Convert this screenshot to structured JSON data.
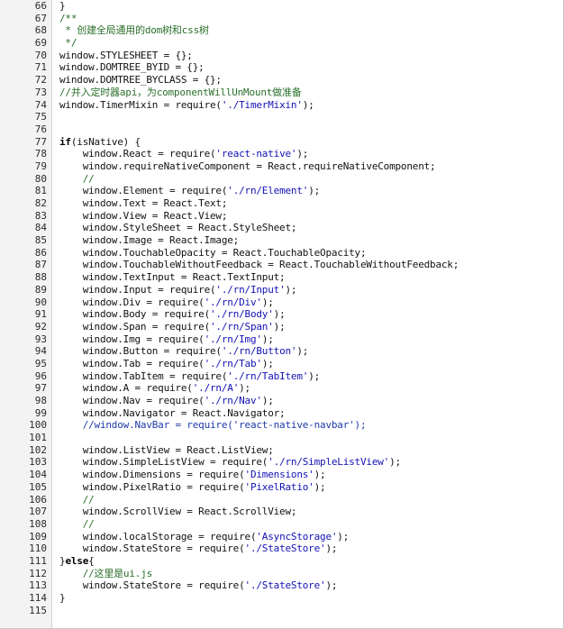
{
  "editor": {
    "colors": {
      "comment": "#2a6f2a",
      "string": "#1212b4",
      "text": "#111111",
      "gutter": "#f3f3f3"
    },
    "lines": [
      {
        "n": "66",
        "segments": [
          {
            "t": "}",
            "c": ""
          }
        ]
      },
      {
        "n": "67",
        "segments": [
          {
            "t": "/**",
            "c": "cm"
          }
        ]
      },
      {
        "n": "68",
        "segments": [
          {
            "t": " * 创建全局通用的dom树和css树",
            "c": "cm"
          }
        ]
      },
      {
        "n": "69",
        "segments": [
          {
            "t": " */",
            "c": "cm"
          }
        ]
      },
      {
        "n": "70",
        "segments": [
          {
            "t": "window.STYLESHEET = {};",
            "c": ""
          }
        ]
      },
      {
        "n": "71",
        "segments": [
          {
            "t": "window.DOMTREE_BYID = {};",
            "c": ""
          }
        ]
      },
      {
        "n": "72",
        "segments": [
          {
            "t": "window.DOMTREE_BYCLASS = {};",
            "c": ""
          }
        ]
      },
      {
        "n": "73",
        "segments": [
          {
            "t": "//并入定时器api，为componentWillUnMount做准备",
            "c": "cm"
          }
        ]
      },
      {
        "n": "74",
        "segments": [
          {
            "t": "window.TimerMixin = require(",
            "c": ""
          },
          {
            "t": "'./TimerMixin'",
            "c": "str"
          },
          {
            "t": ");",
            "c": ""
          }
        ]
      },
      {
        "n": "75",
        "segments": []
      },
      {
        "n": "76",
        "segments": []
      },
      {
        "n": "77",
        "segments": [
          {
            "t": "if",
            "c": "kw"
          },
          {
            "t": "(isNative) {",
            "c": ""
          }
        ]
      },
      {
        "n": "78",
        "segments": [
          {
            "t": "    window.React = require(",
            "c": ""
          },
          {
            "t": "'react-native'",
            "c": "str"
          },
          {
            "t": ");",
            "c": ""
          }
        ]
      },
      {
        "n": "79",
        "segments": [
          {
            "t": "    window.requireNativeComponent = React.requireNativeComponent;",
            "c": ""
          }
        ]
      },
      {
        "n": "80",
        "segments": [
          {
            "t": "    //",
            "c": "cm"
          }
        ]
      },
      {
        "n": "81",
        "segments": [
          {
            "t": "    window.Element = require(",
            "c": ""
          },
          {
            "t": "'./rn/Element'",
            "c": "str"
          },
          {
            "t": ");",
            "c": ""
          }
        ]
      },
      {
        "n": "82",
        "segments": [
          {
            "t": "    window.Text = React.Text;",
            "c": ""
          }
        ]
      },
      {
        "n": "83",
        "segments": [
          {
            "t": "    window.View = React.View;",
            "c": ""
          }
        ]
      },
      {
        "n": "84",
        "segments": [
          {
            "t": "    window.StyleSheet = React.StyleSheet;",
            "c": ""
          }
        ]
      },
      {
        "n": "85",
        "segments": [
          {
            "t": "    window.Image = React.Image;",
            "c": ""
          }
        ]
      },
      {
        "n": "86",
        "segments": [
          {
            "t": "    window.TouchableOpacity = React.TouchableOpacity;",
            "c": ""
          }
        ]
      },
      {
        "n": "87",
        "segments": [
          {
            "t": "    window.TouchableWithoutFeedback = React.TouchableWithoutFeedback;",
            "c": ""
          }
        ]
      },
      {
        "n": "88",
        "segments": [
          {
            "t": "    window.TextInput = React.TextInput;",
            "c": ""
          }
        ]
      },
      {
        "n": "89",
        "segments": [
          {
            "t": "    window.Input = require(",
            "c": ""
          },
          {
            "t": "'./rn/Input'",
            "c": "str"
          },
          {
            "t": ");",
            "c": ""
          }
        ]
      },
      {
        "n": "90",
        "segments": [
          {
            "t": "    window.Div = require(",
            "c": ""
          },
          {
            "t": "'./rn/Div'",
            "c": "str"
          },
          {
            "t": ");",
            "c": ""
          }
        ]
      },
      {
        "n": "91",
        "segments": [
          {
            "t": "    window.Body = require(",
            "c": ""
          },
          {
            "t": "'./rn/Body'",
            "c": "str"
          },
          {
            "t": ");",
            "c": ""
          }
        ]
      },
      {
        "n": "92",
        "segments": [
          {
            "t": "    window.Span = require(",
            "c": ""
          },
          {
            "t": "'./rn/Span'",
            "c": "str"
          },
          {
            "t": ");",
            "c": ""
          }
        ]
      },
      {
        "n": "93",
        "segments": [
          {
            "t": "    window.Img = require(",
            "c": ""
          },
          {
            "t": "'./rn/Img'",
            "c": "str"
          },
          {
            "t": ");",
            "c": ""
          }
        ]
      },
      {
        "n": "94",
        "segments": [
          {
            "t": "    window.Button = require(",
            "c": ""
          },
          {
            "t": "'./rn/Button'",
            "c": "str"
          },
          {
            "t": ");",
            "c": ""
          }
        ]
      },
      {
        "n": "95",
        "segments": [
          {
            "t": "    window.Tab = require(",
            "c": ""
          },
          {
            "t": "'./rn/Tab'",
            "c": "str"
          },
          {
            "t": ");",
            "c": ""
          }
        ]
      },
      {
        "n": "96",
        "segments": [
          {
            "t": "    window.TabItem = require(",
            "c": ""
          },
          {
            "t": "'./rn/TabItem'",
            "c": "str"
          },
          {
            "t": ");",
            "c": ""
          }
        ]
      },
      {
        "n": "97",
        "segments": [
          {
            "t": "    window.A = require(",
            "c": ""
          },
          {
            "t": "'./rn/A'",
            "c": "str"
          },
          {
            "t": ");",
            "c": ""
          }
        ]
      },
      {
        "n": "98",
        "segments": [
          {
            "t": "    window.Nav = require(",
            "c": ""
          },
          {
            "t": "'./rn/Nav'",
            "c": "str"
          },
          {
            "t": ");",
            "c": ""
          }
        ]
      },
      {
        "n": "99",
        "segments": [
          {
            "t": "    window.Navigator = React.Navigator;",
            "c": ""
          }
        ]
      },
      {
        "n": "100",
        "segments": [
          {
            "t": "    //window.NavBar = require('react-native-navbar');",
            "c": "cm-blue"
          }
        ]
      },
      {
        "n": "101",
        "segments": []
      },
      {
        "n": "102",
        "segments": [
          {
            "t": "    window.ListView = React.ListView;",
            "c": ""
          }
        ]
      },
      {
        "n": "103",
        "segments": [
          {
            "t": "    window.SimpleListView = require(",
            "c": ""
          },
          {
            "t": "'./rn/SimpleListView'",
            "c": "str"
          },
          {
            "t": ");",
            "c": ""
          }
        ]
      },
      {
        "n": "104",
        "segments": [
          {
            "t": "    window.Dimensions = require(",
            "c": ""
          },
          {
            "t": "'Dimensions'",
            "c": "str"
          },
          {
            "t": ");",
            "c": ""
          }
        ]
      },
      {
        "n": "105",
        "segments": [
          {
            "t": "    window.PixelRatio = require(",
            "c": ""
          },
          {
            "t": "'PixelRatio'",
            "c": "str"
          },
          {
            "t": ");",
            "c": ""
          }
        ]
      },
      {
        "n": "106",
        "segments": [
          {
            "t": "    //",
            "c": "cm"
          }
        ]
      },
      {
        "n": "107",
        "segments": [
          {
            "t": "    window.ScrollView = React.ScrollView;",
            "c": ""
          }
        ]
      },
      {
        "n": "108",
        "segments": [
          {
            "t": "    //",
            "c": "cm"
          }
        ]
      },
      {
        "n": "109",
        "segments": [
          {
            "t": "    window.localStorage = require(",
            "c": ""
          },
          {
            "t": "'AsyncStorage'",
            "c": "str"
          },
          {
            "t": ");",
            "c": ""
          }
        ]
      },
      {
        "n": "110",
        "segments": [
          {
            "t": "    window.StateStore = require(",
            "c": ""
          },
          {
            "t": "'./StateStore'",
            "c": "str"
          },
          {
            "t": ");",
            "c": ""
          }
        ]
      },
      {
        "n": "111",
        "segments": [
          {
            "t": "}",
            "c": ""
          },
          {
            "t": "else",
            "c": "kw"
          },
          {
            "t": "{",
            "c": ""
          }
        ]
      },
      {
        "n": "112",
        "segments": [
          {
            "t": "    //这里是ui.js",
            "c": "cm"
          }
        ]
      },
      {
        "n": "113",
        "segments": [
          {
            "t": "    window.StateStore = require(",
            "c": ""
          },
          {
            "t": "'./StateStore'",
            "c": "str"
          },
          {
            "t": ");",
            "c": ""
          }
        ]
      },
      {
        "n": "114",
        "segments": [
          {
            "t": "}",
            "c": ""
          }
        ]
      },
      {
        "n": "115",
        "segments": []
      }
    ]
  }
}
